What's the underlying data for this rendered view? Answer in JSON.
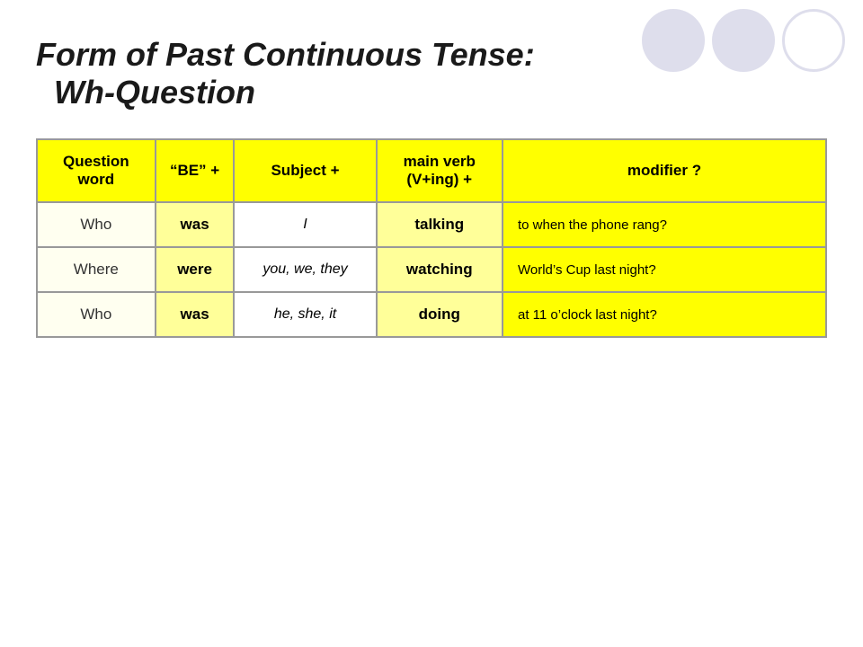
{
  "title": {
    "line1": "Form of Past Continuous Tense:",
    "line2": "Wh-Question"
  },
  "decorative": {
    "circles": [
      "filled",
      "filled",
      "outline"
    ]
  },
  "table": {
    "headers": [
      "Question word",
      "“BE” +",
      "Subject +",
      "main verb (V+ing) +",
      "modifier ?"
    ],
    "rows": [
      {
        "question_word": "Who",
        "be": "was",
        "subject": "I",
        "main_verb": "talking",
        "modifier": "to when the phone rang?"
      },
      {
        "question_word": "Where",
        "be": "were",
        "subject": "you, we, they",
        "main_verb": "watching",
        "modifier": "World’s Cup last night?"
      },
      {
        "question_word": "Who",
        "be": "was",
        "subject": "he, she, it",
        "main_verb": "doing",
        "modifier": "at 11 o’clock last night?"
      }
    ]
  }
}
